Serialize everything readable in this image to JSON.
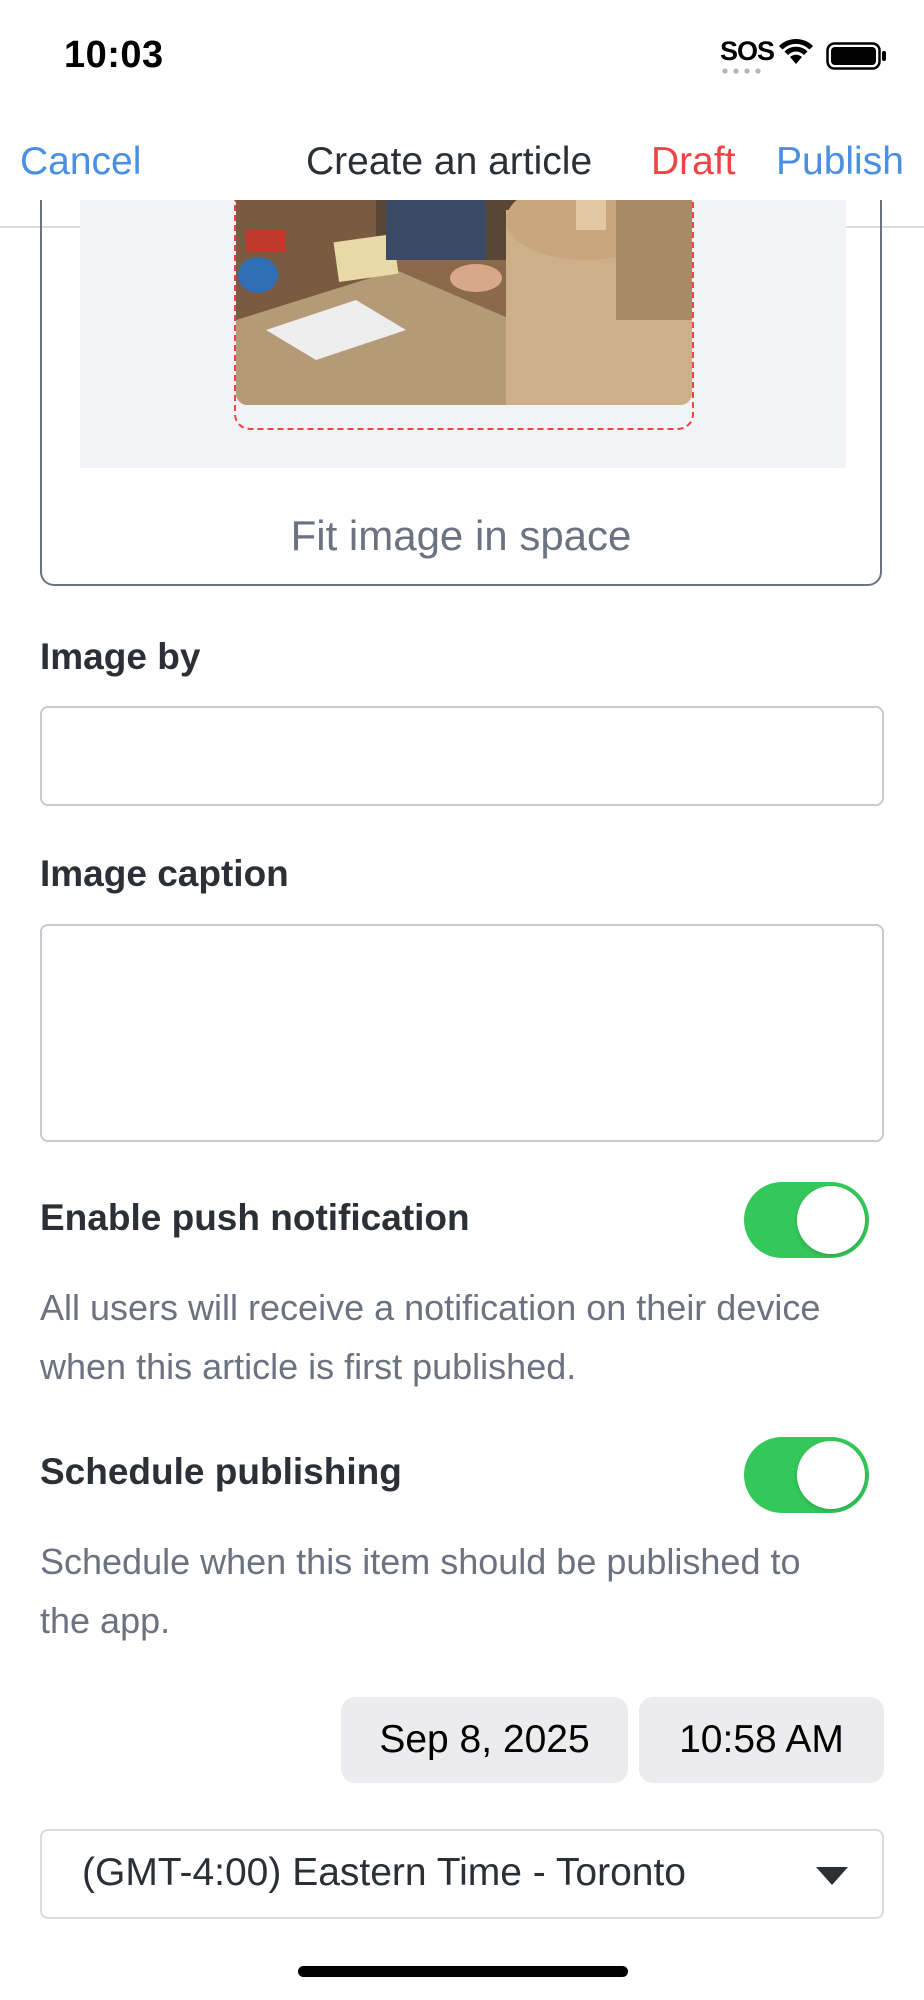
{
  "status_bar": {
    "time": "10:03",
    "sos": "SOS"
  },
  "nav": {
    "cancel": "Cancel",
    "title": "Create an article",
    "draft": "Draft",
    "publish": "Publish"
  },
  "image_card": {
    "fit_label": "Fit image in space"
  },
  "form": {
    "image_by_label": "Image by",
    "image_by_value": "",
    "image_caption_label": "Image caption",
    "image_caption_value": "",
    "push_label": "Enable push notification",
    "push_enabled": true,
    "push_help": "All users will receive a notification on their device when this article is first published.",
    "schedule_label": "Schedule publishing",
    "schedule_enabled": true,
    "schedule_help": "Schedule when this item should be published to the app.",
    "date": "Sep 8, 2025",
    "time": "10:58 AM",
    "timezone": "(GMT-4:00) Eastern Time - Toronto"
  },
  "colors": {
    "link": "#4a90e2",
    "draft": "#ef4444",
    "toggle_on": "#34c759"
  }
}
